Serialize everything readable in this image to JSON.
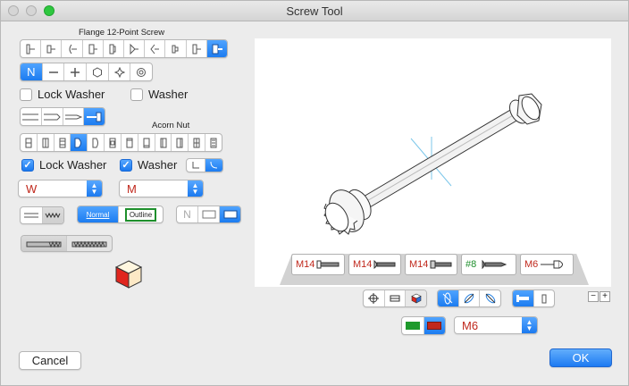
{
  "window": {
    "title": "Screw Tool"
  },
  "labels": {
    "flange": "Flange 12-Point Screw",
    "acorn": "Acorn Nut"
  },
  "checks": {
    "lock_washer_1": {
      "label": "Lock Washer",
      "checked": false
    },
    "washer_1": {
      "label": "Washer",
      "checked": false
    },
    "lock_washer_2": {
      "label": "Lock Washer",
      "checked": true
    },
    "washer_2": {
      "label": "Washer",
      "checked": true
    }
  },
  "selectors": {
    "head_style": {
      "label": "N"
    },
    "normal": "Normal",
    "outline": "Outline",
    "n_option": "N"
  },
  "popups": {
    "thread_left": "W",
    "thread_right": "M",
    "size": "M6"
  },
  "chips": [
    {
      "label": "M14",
      "color": "red"
    },
    {
      "label": "M14",
      "color": "red"
    },
    {
      "label": "M14",
      "color": "red"
    },
    {
      "label": "#8",
      "color": "green"
    },
    {
      "label": "M6",
      "color": "red"
    }
  ],
  "zoom": {
    "minus": "−",
    "plus": "+"
  },
  "buttons": {
    "cancel": "Cancel",
    "ok": "OK"
  },
  "colors": {
    "accent": "#1c7cf0",
    "red": "#c0281c",
    "green": "#1e8f2c"
  }
}
